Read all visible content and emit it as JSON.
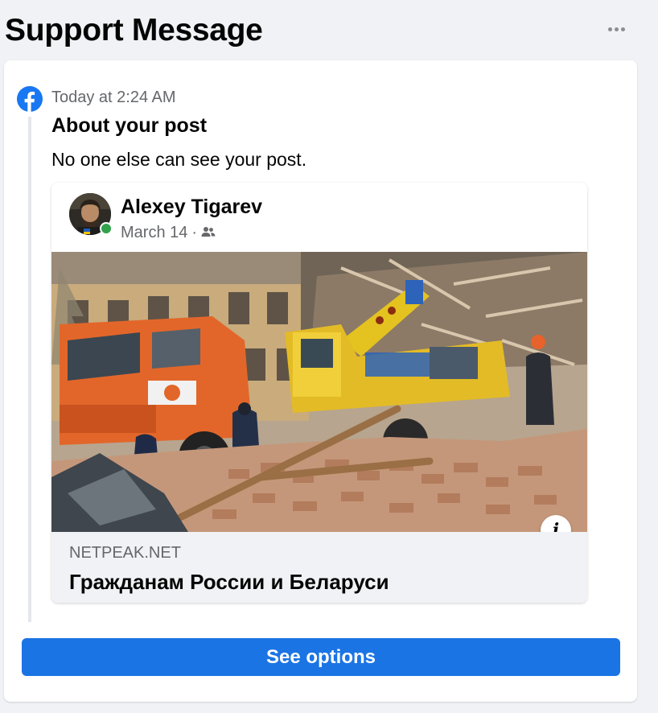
{
  "header": {
    "title": "Support Message",
    "more_icon": "more-horizontal-icon"
  },
  "message": {
    "sender_icon": "facebook-logo-icon",
    "timestamp": "Today at 2:24 AM",
    "title": "About your post",
    "body": "No one else can see your post."
  },
  "post": {
    "author": "Alexey Tigarev",
    "date": "March 14",
    "separator": "·",
    "audience_icon": "friends-icon",
    "online": true,
    "image_icon": "news-photo-excavator-rubble",
    "info_icon": "info-icon",
    "link_domain": "NETPEAK.NET",
    "link_title": "Гражданам России и Беларуси"
  },
  "actions": {
    "see_options": "See options"
  },
  "colors": {
    "background": "#f0f2f5",
    "card": "#ffffff",
    "primary_button": "#1b74e4",
    "facebook_blue": "#1877f2",
    "online": "#31a24c",
    "secondary_text": "#65676b"
  }
}
